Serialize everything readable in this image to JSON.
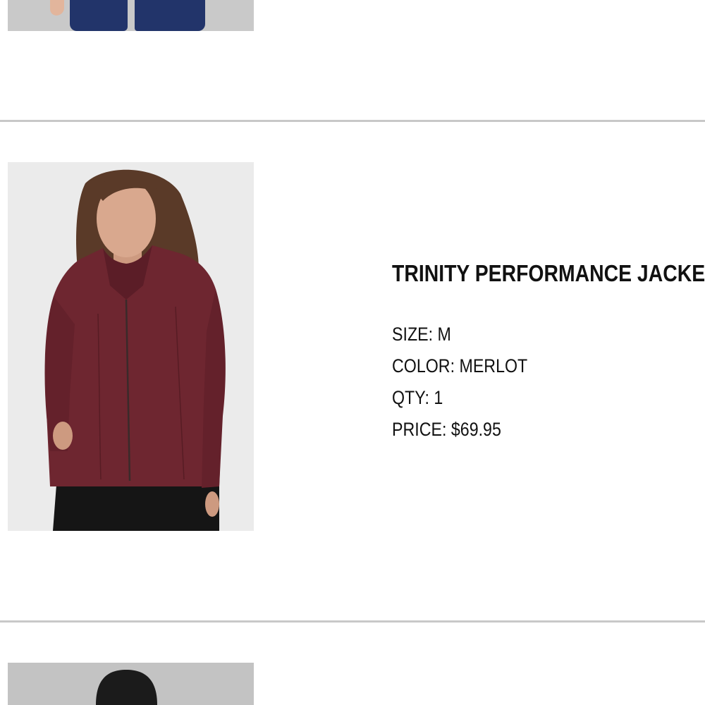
{
  "items": [
    {
      "image_alt": "Navy leggings",
      "colors": {
        "background": "#c9c9c9",
        "garment": "#22346a"
      }
    },
    {
      "name": "TRINITY PERFORMANCE JACKET",
      "size_label": "SIZE: M",
      "color_label": "COLOR: MERLOT",
      "qty_label": "QTY: 1",
      "price_label": "PRICE: $69.95",
      "colors": {
        "background": "#ebebeb",
        "garment": "#6e2630"
      }
    },
    {
      "image_alt": "Next item",
      "colors": {
        "background": "#c3c3c3"
      }
    }
  ],
  "colors": {
    "divider": "#c8c8c8",
    "text": "#111111"
  }
}
